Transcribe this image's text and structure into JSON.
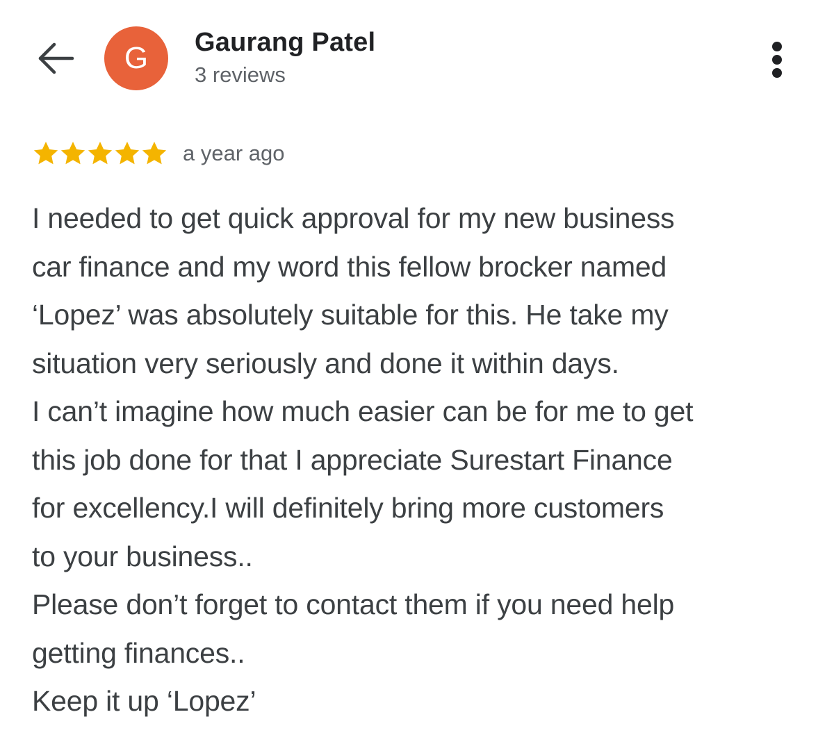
{
  "header": {
    "avatar_letter": "G",
    "reviewer_name": "Gaurang Patel",
    "reviews_count": "3 reviews",
    "avatar_color": "#e8623a",
    "back_icon": "arrow-left-icon",
    "more_icon": "more-vertical-icon"
  },
  "review": {
    "rating": 5,
    "rating_max": 5,
    "star_color": "#f4b400",
    "timestamp": "a year ago",
    "lines": [
      "I needed to get quick approval for my new business",
      "car finance and my word this fellow brocker named",
      "‘Lopez’ was absolutely suitable for this. He take my",
      "situation very seriously and done it within days.",
      "I can’t imagine how much easier can be for me to get",
      "this job done for that I appreciate Surestart Finance",
      "for excellency.I will definitely bring more customers",
      "to your business..",
      "Please don’t forget to contact them if you need help",
      "getting finances..",
      "Keep it up ‘Lopez’"
    ]
  }
}
